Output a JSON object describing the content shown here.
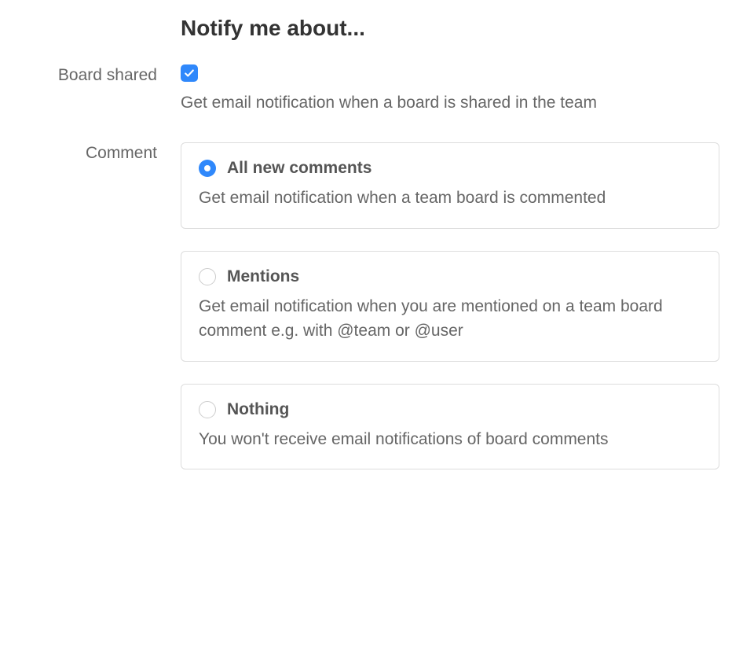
{
  "page": {
    "title": "Notify me about..."
  },
  "boardShared": {
    "label": "Board shared",
    "checked": true,
    "helper": "Get email notification when a board is shared in the team"
  },
  "comment": {
    "label": "Comment",
    "options": [
      {
        "title": "All new comments",
        "desc": "Get email notification when a team board is commented",
        "selected": true
      },
      {
        "title": "Mentions",
        "desc": "Get email notification when you are mentioned on a team board comment e.g. with @team or @user",
        "selected": false
      },
      {
        "title": "Nothing",
        "desc": "You won't receive email notifications of board comments",
        "selected": false
      }
    ]
  }
}
